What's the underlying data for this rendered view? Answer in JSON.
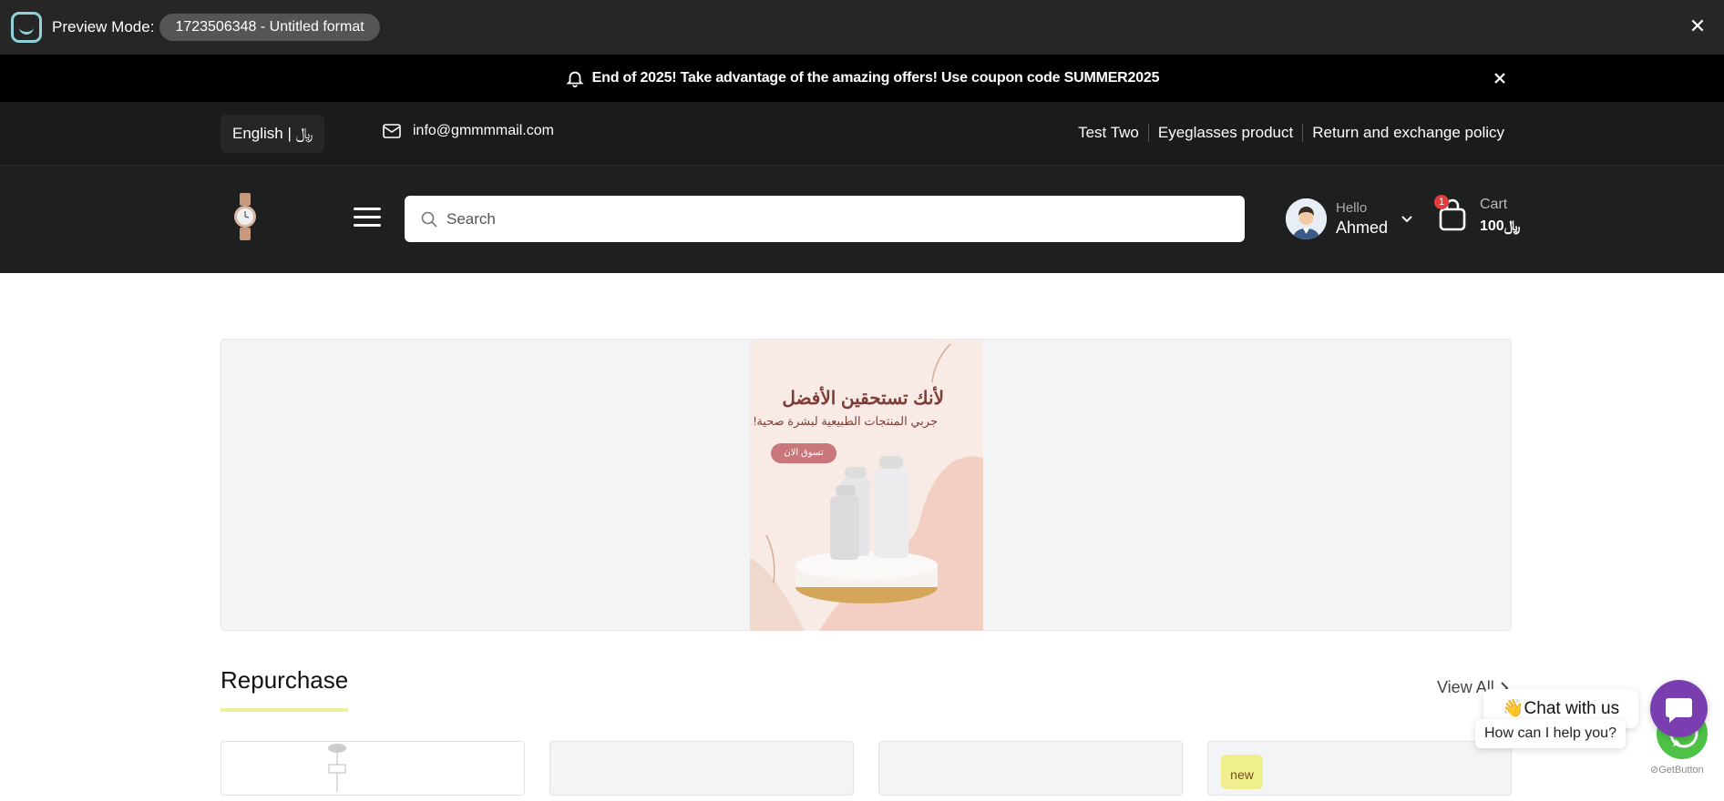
{
  "preview_bar": {
    "label": "Preview Mode:",
    "pill": "1723506348 - Untitled format",
    "close": "✕"
  },
  "promo": {
    "text": "End of 2025! Take advantage of the amazing offers! Use coupon code SUMMER2025"
  },
  "info_bar": {
    "language": "English | ﷼",
    "email": "info@gmmmmail.com",
    "links": [
      "Test Two",
      "Eyeglasses product",
      "Return and exchange policy"
    ]
  },
  "header": {
    "search_placeholder": "Search",
    "user": {
      "greeting": "Hello",
      "name": "Ahmed"
    },
    "cart": {
      "label": "Cart",
      "total": "100﷼",
      "count": "1"
    }
  },
  "banner": {
    "headline": "لأنك تستحقين الأفضل",
    "subtext": "جربي المنتجات الطبيعية لبشرة صحية!",
    "cta": "تسوق الان"
  },
  "section": {
    "title": "Repurchase",
    "view_all": "View All"
  },
  "products": [
    {
      "badge": ""
    },
    {
      "badge": ""
    },
    {
      "badge": ""
    },
    {
      "badge": "new"
    }
  ],
  "chat": {
    "bubble": "👋Chat with us",
    "help": "How can I help you?",
    "powered": "GetButton"
  },
  "colors": {
    "accent_underline": "#eeee9a",
    "chat_purple": "#7a3eb1",
    "whatsapp_green": "#4dc247",
    "badge_red": "#e23b3b"
  }
}
